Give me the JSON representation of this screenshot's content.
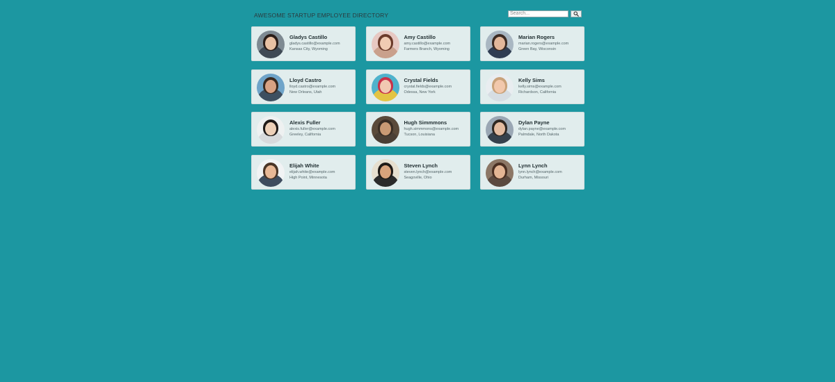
{
  "header": {
    "title": "AWESOME STARTUP EMPLOYEE DIRECTORY",
    "search": {
      "placeholder": "Search...",
      "value": "",
      "button_icon": "search-icon"
    }
  },
  "employees": [
    {
      "name": "Gladys Castillo",
      "email": "gladys.castillo@example.com",
      "location": "Kansas City, Wyoming",
      "avatar": {
        "bg": "#7e8a92",
        "hair": "#2a1d18",
        "skin": "#e8c1a3",
        "shirt": "#3f4a55"
      }
    },
    {
      "name": "Amy Castillo",
      "email": "amy.castillo@example.com",
      "location": "Farmers Branch, Wyoming",
      "avatar": {
        "bg": "#e7c8c2",
        "hair": "#6b3a2a",
        "skin": "#f0cbb3",
        "shirt": "#c9a08c"
      }
    },
    {
      "name": "Marian Rogers",
      "email": "marian.rogers@example.com",
      "location": "Green Bay, Wisconsin",
      "avatar": {
        "bg": "#a9b7c2",
        "hair": "#3c2b22",
        "skin": "#e2b79a",
        "shirt": "#2f3d52"
      }
    },
    {
      "name": "Lloyd Castro",
      "email": "lloyd.castro@example.com",
      "location": "New Orleans, Utah",
      "avatar": {
        "bg": "#6fa4c9",
        "hair": "#3a2a20",
        "skin": "#d9a283",
        "shirt": "#3d4f60"
      }
    },
    {
      "name": "Crystal Fields",
      "email": "crystal.fields@example.com",
      "location": "Odessa, New York",
      "avatar": {
        "bg": "#4fb2cc",
        "hair": "#c7324a",
        "skin": "#f1c9b2",
        "shirt": "#e3c444"
      }
    },
    {
      "name": "Kelly Sims",
      "email": "kelly.sims@example.com",
      "location": "Richardson, California",
      "avatar": {
        "bg": "#e9edf0",
        "hair": "#c9a27a",
        "skin": "#f2c8ac",
        "shirt": "#d6dde3"
      }
    },
    {
      "name": "Alexis Fuller",
      "email": "alexis.fuller@example.com",
      "location": "Greeley, California",
      "avatar": {
        "bg": "#eef1f1",
        "hair": "#1f1a18",
        "skin": "#edd0b8",
        "shirt": "#d7dadc"
      }
    },
    {
      "name": "Hugh Simmmons",
      "email": "hugh.simmmons@example.com",
      "location": "Tucson, Louisiana",
      "avatar": {
        "bg": "#5a4a3a",
        "hair": "#3a2e24",
        "skin": "#c99a74",
        "shirt": "#4a3f35"
      }
    },
    {
      "name": "Dylan Payne",
      "email": "dylan.payne@example.com",
      "location": "Palmdale, North Dakota",
      "avatar": {
        "bg": "#9aa7b4",
        "hair": "#2f2722",
        "skin": "#e4bba0",
        "shirt": "#36414d"
      }
    },
    {
      "name": "Elijah White",
      "email": "elijah.white@example.com",
      "location": "High Point, Minnesota",
      "avatar": {
        "bg": "#f1f3f4",
        "hair": "#4a3426",
        "skin": "#e8b896",
        "shirt": "#3e4c5e"
      }
    },
    {
      "name": "Steven Lynch",
      "email": "steven.lynch@example.com",
      "location": "Seagoville, Ohio",
      "avatar": {
        "bg": "#e6dfcf",
        "hair": "#1f1a16",
        "skin": "#d8a37c",
        "shirt": "#2b2b2b"
      }
    },
    {
      "name": "Lynn Lynch",
      "email": "lynn.lynch@example.com",
      "location": "Durham, Missouri",
      "avatar": {
        "bg": "#8c7766",
        "hair": "#4a2f22",
        "skin": "#e3b594",
        "shirt": "#5b4a40"
      }
    }
  ]
}
